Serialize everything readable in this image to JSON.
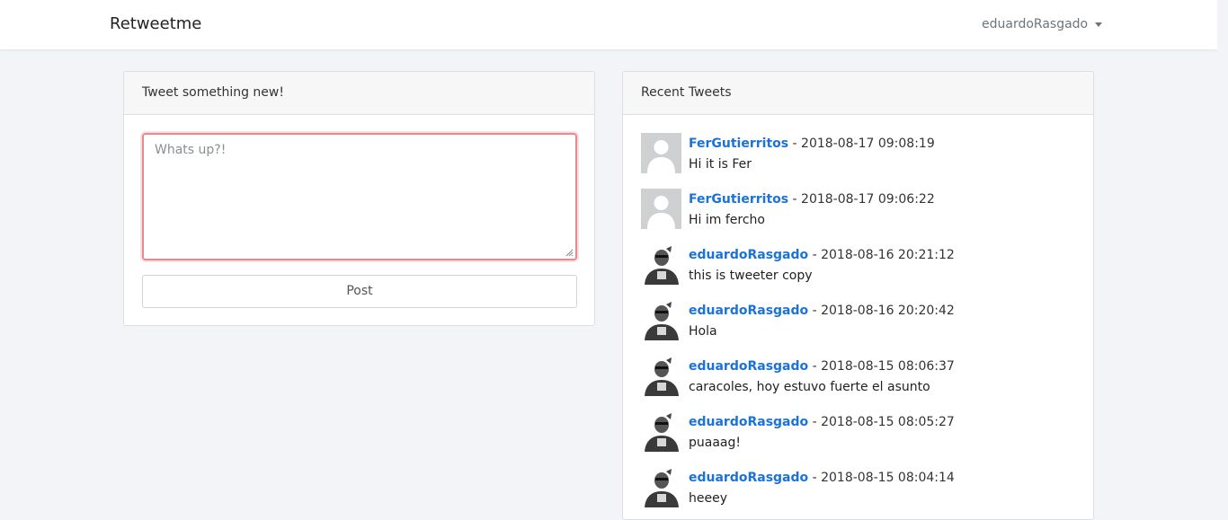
{
  "navbar": {
    "brand": "Retweetme",
    "user": "eduardoRasgado"
  },
  "compose": {
    "header": "Tweet something new!",
    "placeholder": "Whats up?!",
    "post_label": "Post"
  },
  "feed": {
    "header": "Recent Tweets",
    "separator": " - ",
    "tweets": [
      {
        "user": "FerGutierritos",
        "time": "2018-08-17 09:08:19",
        "text": "Hi it is Fer",
        "avatar": "default-avatar-icon"
      },
      {
        "user": "FerGutierritos",
        "time": "2018-08-17 09:06:22",
        "text": "Hi im fercho",
        "avatar": "default-avatar-icon"
      },
      {
        "user": "eduardoRasgado",
        "time": "2018-08-16 20:21:12",
        "text": "this is tweeter copy",
        "avatar": "user-photo"
      },
      {
        "user": "eduardoRasgado",
        "time": "2018-08-16 20:20:42",
        "text": "Hola",
        "avatar": "user-photo"
      },
      {
        "user": "eduardoRasgado",
        "time": "2018-08-15 08:06:37",
        "text": "caracoles, hoy estuvo fuerte el asunto",
        "avatar": "user-photo"
      },
      {
        "user": "eduardoRasgado",
        "time": "2018-08-15 08:05:27",
        "text": "puaaag!",
        "avatar": "user-photo"
      },
      {
        "user": "eduardoRasgado",
        "time": "2018-08-15 08:04:14",
        "text": "heeey",
        "avatar": "user-photo"
      }
    ]
  },
  "colors": {
    "link": "#1b72d8",
    "focus_border": "#e8898f",
    "background": "#f2f4f7"
  }
}
